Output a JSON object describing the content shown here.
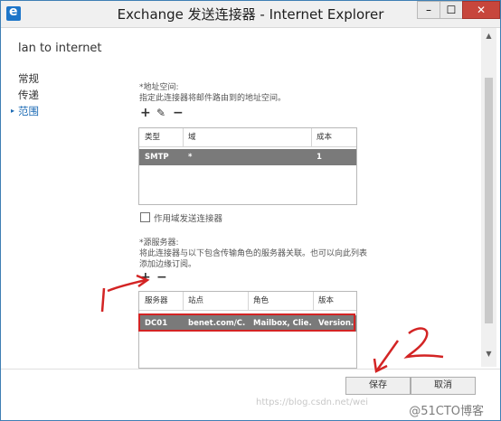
{
  "window": {
    "title": "Exchange 发送连接器 - Internet Explorer",
    "controls": {
      "minimize": "–",
      "maximize": "☐",
      "close": "✕"
    }
  },
  "page": {
    "title": "lan to internet"
  },
  "nav": {
    "items": [
      {
        "label": "常规",
        "active": false
      },
      {
        "label": "传递",
        "active": false
      },
      {
        "label": "范围",
        "active": true
      }
    ]
  },
  "address_space": {
    "label": "*地址空间:",
    "description": "指定此连接器将邮件路由到的地址空间。",
    "toolbar": {
      "add": "+",
      "edit": "✎",
      "remove": "−"
    },
    "columns": [
      "类型",
      "域",
      "成本"
    ],
    "rows": [
      {
        "type": "SMTP",
        "domain": "*",
        "cost": "1"
      }
    ]
  },
  "scoped_connector": {
    "label": "作用域发送连接器",
    "checked": false
  },
  "source_servers": {
    "label": "*源服务器:",
    "description_line1": "将此连接器与以下包含传输角色的服务器关联。也可以向此列表",
    "description_line2": "添加边缘订阅。",
    "toolbar": {
      "add": "+",
      "remove": "−"
    },
    "columns": [
      "服务器",
      "站点",
      "角色",
      "版本"
    ],
    "rows": [
      {
        "server": "DC01",
        "site": "benet.com/C...",
        "role": "Mailbox, Clie...",
        "version": "Version..."
      }
    ]
  },
  "annotations": {
    "mark_1": "1",
    "mark_2": "2"
  },
  "footer": {
    "save_label": "保存",
    "cancel_label": "取消"
  },
  "scrollbar": {
    "up": "▲",
    "down": "▼"
  },
  "watermark": {
    "brand": "@51CTO博客",
    "url": "https://blog.csdn.net/wei"
  },
  "colors": {
    "selection": "#7a7a7a",
    "annotation": "#d32424",
    "link": "#1b6ab4"
  }
}
